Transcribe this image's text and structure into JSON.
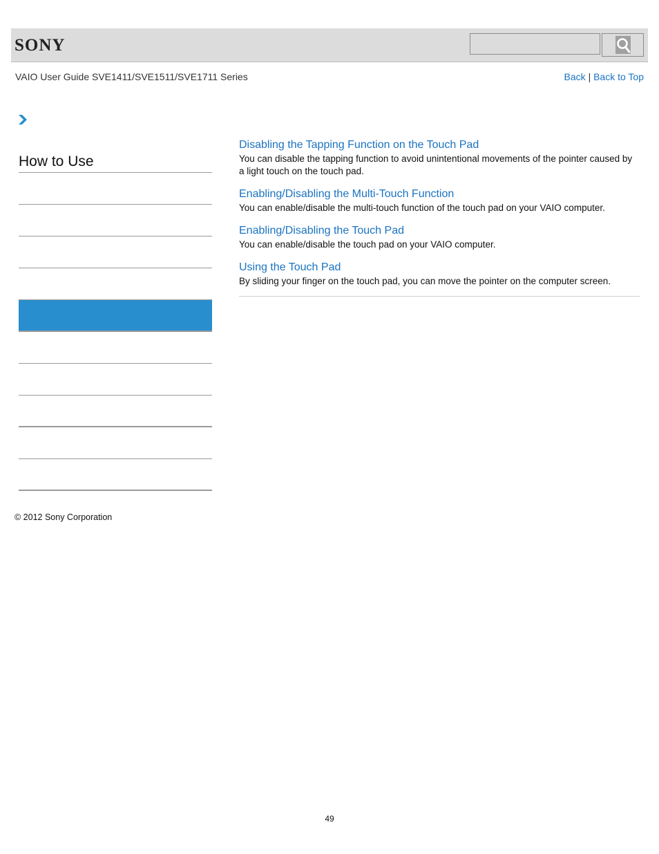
{
  "header": {
    "logo": "SONY",
    "search": {
      "value": "",
      "placeholder": ""
    },
    "search_icon": "search-icon"
  },
  "subheader": {
    "guide_title": "VAIO User Guide SVE1411/SVE1511/SVE1711 Series",
    "back_label": "Back",
    "separator": "|",
    "back_to_top_label": "Back to Top"
  },
  "breadcrumb": {
    "icon": "chevron-right-icon"
  },
  "sidebar": {
    "title": "How to Use",
    "items": [
      {
        "label": "",
        "active": false
      },
      {
        "label": "",
        "active": false
      },
      {
        "label": "",
        "active": false
      },
      {
        "label": "",
        "active": false
      },
      {
        "label": "",
        "active": true
      },
      {
        "label": "",
        "active": false
      },
      {
        "label": "",
        "active": false
      },
      {
        "label": "",
        "active": false
      },
      {
        "label": "",
        "active": false
      },
      {
        "label": "",
        "active": false
      }
    ]
  },
  "topics": [
    {
      "title": "Disabling the Tapping Function on the Touch Pad",
      "description": "You can disable the tapping function to avoid unintentional movements of the pointer caused by a light touch on the touch pad."
    },
    {
      "title": "Enabling/Disabling the Multi-Touch Function",
      "description": "You can enable/disable the multi-touch function of the touch pad on your VAIO computer."
    },
    {
      "title": "Enabling/Disabling the Touch Pad",
      "description": "You can enable/disable the touch pad on your VAIO computer."
    },
    {
      "title": "Using the Touch Pad",
      "description": "By sliding your finger on the touch pad, you can move the pointer on the computer screen."
    }
  ],
  "footer": {
    "copyright": "© 2012 Sony Corporation",
    "page_number": "49"
  },
  "colors": {
    "link": "#1a73c1",
    "active_item": "#288ecd",
    "header_bg": "#dcdcdc"
  }
}
